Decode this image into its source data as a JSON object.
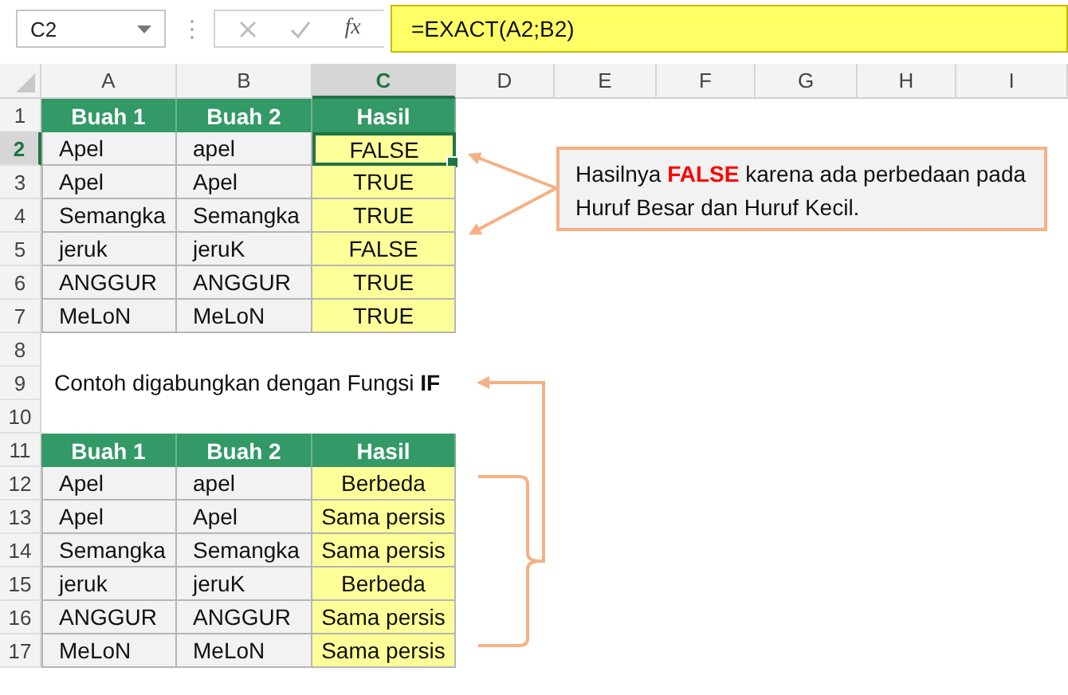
{
  "formula_bar": {
    "name_box": "C2",
    "function_label": "fx",
    "formula": "=EXACT(A2;B2)"
  },
  "columns": [
    {
      "label": "A",
      "selected": false
    },
    {
      "label": "B",
      "selected": false
    },
    {
      "label": "C",
      "selected": true
    },
    {
      "label": "D",
      "selected": false
    },
    {
      "label": "E",
      "selected": false
    },
    {
      "label": "F",
      "selected": false
    },
    {
      "label": "G",
      "selected": false
    },
    {
      "label": "H",
      "selected": false
    },
    {
      "label": "I",
      "selected": false
    }
  ],
  "row_headers": [
    {
      "label": "1",
      "selected": false
    },
    {
      "label": "2",
      "selected": true
    },
    {
      "label": "3",
      "selected": false
    },
    {
      "label": "4",
      "selected": false
    },
    {
      "label": "5",
      "selected": false
    },
    {
      "label": "6",
      "selected": false
    },
    {
      "label": "7",
      "selected": false
    },
    {
      "label": "8",
      "selected": false
    },
    {
      "label": "9",
      "selected": false
    },
    {
      "label": "10",
      "selected": false
    },
    {
      "label": "11",
      "selected": false
    },
    {
      "label": "12",
      "selected": false
    },
    {
      "label": "13",
      "selected": false
    },
    {
      "label": "14",
      "selected": false
    },
    {
      "label": "15",
      "selected": false
    },
    {
      "label": "16",
      "selected": false
    },
    {
      "label": "17",
      "selected": false
    }
  ],
  "table_exact": {
    "header": [
      "Buah 1",
      "Buah 2",
      "Hasil"
    ],
    "rows": [
      {
        "buah_1": "Apel",
        "buah_2": "apel",
        "hasil": "FALSE",
        "selected": true
      },
      {
        "buah_1": "Apel",
        "buah_2": "Apel",
        "hasil": "TRUE",
        "selected": false
      },
      {
        "buah_1": "Semangka",
        "buah_2": "Semangka",
        "hasil": "TRUE",
        "selected": false
      },
      {
        "buah_1": "jeruk",
        "buah_2": "jeruK",
        "hasil": "FALSE",
        "selected": false
      },
      {
        "buah_1": "ANGGUR",
        "buah_2": "ANGGUR",
        "hasil": "TRUE",
        "selected": false
      },
      {
        "buah_1": "MeLoN",
        "buah_2": "MeLoN",
        "hasil": "TRUE",
        "selected": false
      }
    ]
  },
  "note": "Contoh digabungkan dengan Fungsi **IF**",
  "table_if": {
    "header": [
      "Buah 1",
      "Buah 2",
      "Hasil"
    ],
    "rows": [
      {
        "buah_1": "Apel",
        "buah_2": "apel",
        "hasil": "Berbeda",
        "selected": false
      },
      {
        "buah_1": "Apel",
        "buah_2": "Apel",
        "hasil": "Sama persis",
        "selected": false
      },
      {
        "buah_1": "Semangka",
        "buah_2": "Semangka",
        "hasil": "Sama persis",
        "selected": false
      },
      {
        "buah_1": "jeruk",
        "buah_2": "jeruK",
        "hasil": "Berbeda",
        "selected": false
      },
      {
        "buah_1": "ANGGUR",
        "buah_2": "ANGGUR",
        "hasil": "Sama persis",
        "selected": false
      },
      {
        "buah_1": "MeLoN",
        "buah_2": "MeLoN",
        "hasil": "Sama persis",
        "selected": false
      }
    ]
  },
  "callout": "Hasilnya **FALSE** karena ada perbedaan pada Huruf Besar dan Huruf Kecil."
}
